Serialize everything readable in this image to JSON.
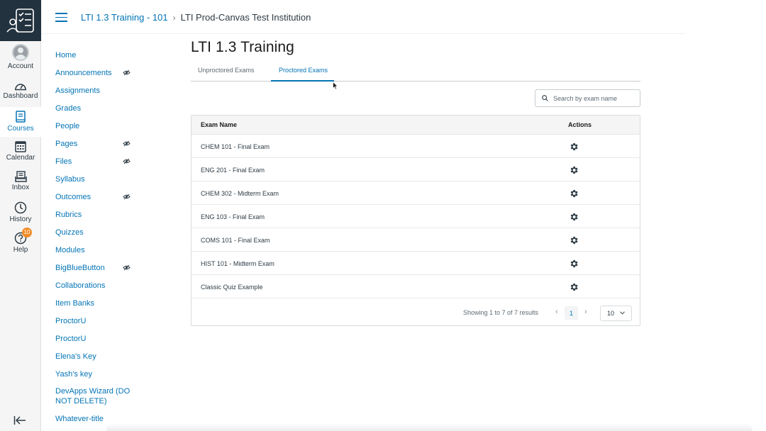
{
  "breadcrumb": {
    "course": "LTI 1.3 Training - 101",
    "current": "LTI Prod-Canvas Test Institution"
  },
  "global_nav": [
    {
      "label": "Account",
      "icon": "account-avatar-icon"
    },
    {
      "label": "Dashboard",
      "icon": "dashboard-icon"
    },
    {
      "label": "Courses",
      "icon": "courses-icon",
      "active": true
    },
    {
      "label": "Calendar",
      "icon": "calendar-icon"
    },
    {
      "label": "Inbox",
      "icon": "inbox-icon"
    },
    {
      "label": "History",
      "icon": "history-icon"
    },
    {
      "label": "Help",
      "icon": "help-icon",
      "badge": "10"
    }
  ],
  "course_nav": [
    {
      "label": "Home"
    },
    {
      "label": "Announcements",
      "hidden": true
    },
    {
      "label": "Assignments"
    },
    {
      "label": "Grades"
    },
    {
      "label": "People"
    },
    {
      "label": "Pages",
      "hidden": true
    },
    {
      "label": "Files",
      "hidden": true
    },
    {
      "label": "Syllabus"
    },
    {
      "label": "Outcomes",
      "hidden": true
    },
    {
      "label": "Rubrics"
    },
    {
      "label": "Quizzes"
    },
    {
      "label": "Modules"
    },
    {
      "label": "BigBlueButton",
      "hidden": true
    },
    {
      "label": "Collaborations"
    },
    {
      "label": "Item Banks"
    },
    {
      "label": "ProctorU"
    },
    {
      "label": "ProctorU"
    },
    {
      "label": "Elena's Key"
    },
    {
      "label": "Yash's key"
    },
    {
      "label": "DevApps Wizard (DO NOT DELETE)"
    },
    {
      "label": "Whatever-title"
    }
  ],
  "main": {
    "title": "LTI 1.3 Training",
    "tabs": [
      {
        "label": "Unproctored Exams"
      },
      {
        "label": "Proctored Exams",
        "active": true
      }
    ],
    "search": {
      "placeholder": "Search by exam name",
      "value": ""
    },
    "table": {
      "headers": [
        "Exam Name",
        "Actions"
      ],
      "rows": [
        "CHEM 101 - Final Exam",
        "ENG 201 - Final Exam",
        "CHEM 302 - Midterm Exam",
        "ENG 103 - Final Exam",
        "COMS 101 - Final Exam",
        "HIST 101 - Midterm Exam",
        "Classic Quiz Example"
      ]
    },
    "pagination": {
      "showing": "Showing 1 to 7 of 7 results",
      "prev": "‹",
      "current_page": "1",
      "next": "›",
      "page_size": "10"
    }
  },
  "colors": {
    "brand_dark": "#22323e",
    "link": "#0374b5",
    "badge": "#f38c26",
    "text": "#2d3b45"
  }
}
